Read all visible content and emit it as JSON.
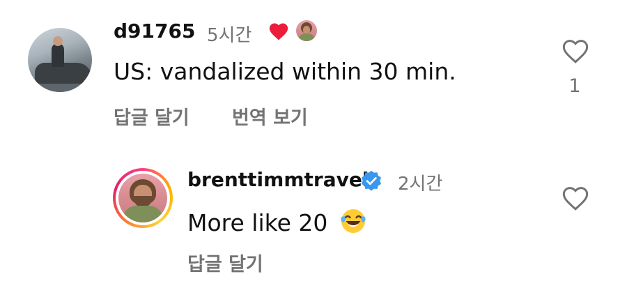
{
  "comment": {
    "username": "d91765",
    "time": "5시간",
    "text": "US: vandalized within 30 min.",
    "reply_label": "답글 달기",
    "translate_label": "번역 보기",
    "like_count": "1"
  },
  "reply": {
    "username": "brenttimmtravel",
    "time": "2시간",
    "text": "More like 20",
    "reply_label": "답글 달기"
  },
  "colors": {
    "liked_heart": "#ed1c3a",
    "verified_badge": "#3897f0",
    "secondary_text": "#737373"
  },
  "icons": {
    "creator_like": "heart-icon",
    "verified": "verified-badge-icon",
    "like_button": "heart-outline-icon",
    "emoji": "laughing-tears-emoji-icon"
  }
}
